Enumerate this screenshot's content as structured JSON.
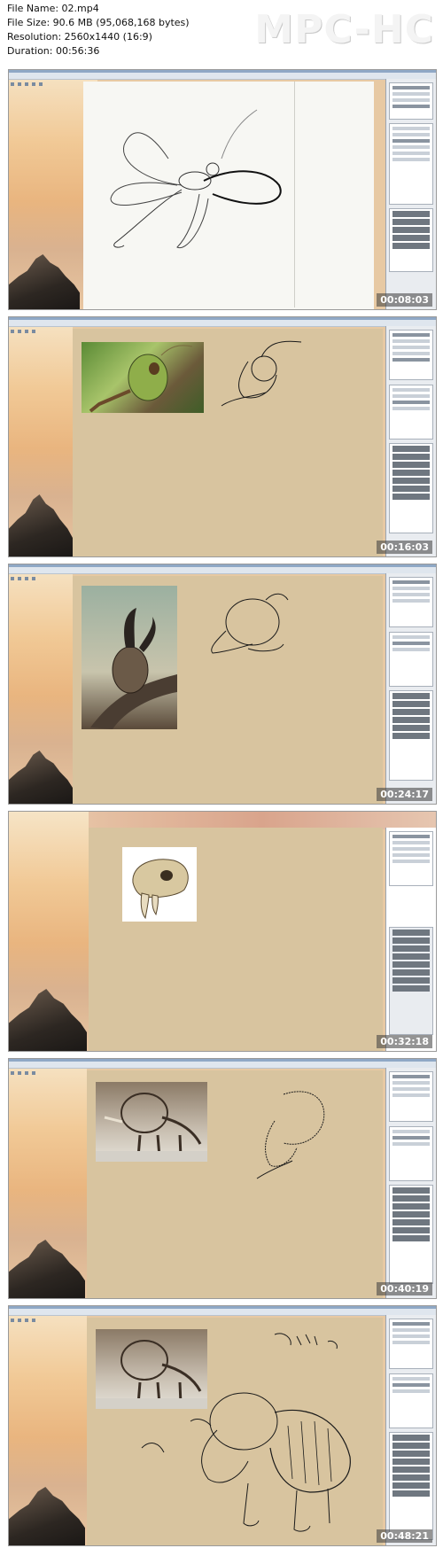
{
  "file_info": {
    "file_name": "File Name: 02.mp4",
    "file_size": "File Size: 90.6 MB (95,068,168 bytes)",
    "resolution": "Resolution: 2560x1440 (16:9)",
    "duration": "Duration: 00:56:36"
  },
  "logo": "MPC-HC",
  "thumbnails": [
    {
      "timestamp": "00:08:03",
      "scene": "dragonfly-sketch-on-white"
    },
    {
      "timestamp": "00:16:03",
      "scene": "grasshopper-reference-and-sketch"
    },
    {
      "timestamp": "00:24:17",
      "scene": "rhinoceros-beetle-reference-and-sketch"
    },
    {
      "timestamp": "00:32:18",
      "scene": "sabertooth-skull-reference"
    },
    {
      "timestamp": "00:40:19",
      "scene": "triceratops-skeleton-reference-and-sketch"
    },
    {
      "timestamp": "00:48:21",
      "scene": "creature-sketch-with-skeleton"
    }
  ],
  "colors": {
    "canvas_tan": "#d8c49f",
    "canvas_white": "#f7f7f3",
    "panel_bg": "#e9ecf0",
    "wallpaper": "#f1c996",
    "sketch_ink": "#1a1a1a"
  }
}
